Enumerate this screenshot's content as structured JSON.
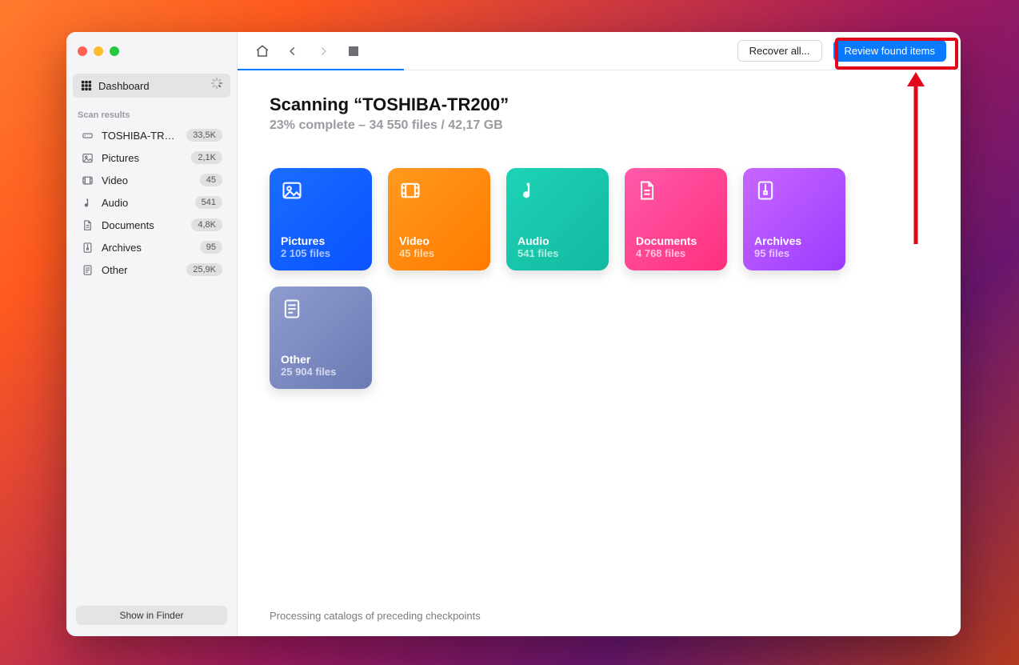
{
  "sidebar": {
    "dashboard_label": "Dashboard",
    "section_title": "Scan results",
    "items": [
      {
        "label": "TOSHIBA-TR200",
        "count": "33,5K",
        "icon": "drive-icon"
      },
      {
        "label": "Pictures",
        "count": "2,1K",
        "icon": "picture-icon"
      },
      {
        "label": "Video",
        "count": "45",
        "icon": "video-icon"
      },
      {
        "label": "Audio",
        "count": "541",
        "icon": "audio-icon"
      },
      {
        "label": "Documents",
        "count": "4,8K",
        "icon": "document-icon"
      },
      {
        "label": "Archives",
        "count": "95",
        "icon": "archive-icon"
      },
      {
        "label": "Other",
        "count": "25,9K",
        "icon": "other-icon"
      }
    ],
    "footer_button": "Show in Finder"
  },
  "toolbar": {
    "recover_label": "Recover all...",
    "review_label": "Review found items"
  },
  "scan": {
    "title": "Scanning “TOSHIBA-TR200”",
    "subtitle": "23% complete – 34 550 files / 42,17 GB",
    "progress_percent": 23,
    "status_message": "Processing catalogs of preceding checkpoints"
  },
  "cards": [
    {
      "title": "Pictures",
      "sub": "2 105 files",
      "icon": "picture-icon",
      "bg": "linear-gradient(135deg,#1a6dff,#0a52ff)",
      "sub_color": "#bcd6ff"
    },
    {
      "title": "Video",
      "sub": "45 files",
      "icon": "video-icon",
      "bg": "linear-gradient(135deg,#ff9a1e,#ff7a00)",
      "sub_color": "#ffe1b8"
    },
    {
      "title": "Audio",
      "sub": "541 files",
      "icon": "audio-icon",
      "bg": "linear-gradient(135deg,#1ed3b5,#12b9a0)",
      "sub_color": "#c3f3ea"
    },
    {
      "title": "Documents",
      "sub": "4 768 files",
      "icon": "document-icon",
      "bg": "linear-gradient(135deg,#ff5aa9,#ff2f7e)",
      "sub_color": "#ffd0e3"
    },
    {
      "title": "Archives",
      "sub": "95 files",
      "icon": "archive-icon",
      "bg": "linear-gradient(135deg,#c866ff,#9b3cff)",
      "sub_color": "#ecd4ff"
    },
    {
      "title": "Other",
      "sub": "25 904 files",
      "icon": "other-icon",
      "bg": "linear-gradient(135deg,#8e9ccf,#6b7ab3)",
      "sub_color": "#dfe4f3"
    }
  ],
  "colors": {
    "annotation": "#e2061a",
    "primary": "#0a7bff"
  }
}
